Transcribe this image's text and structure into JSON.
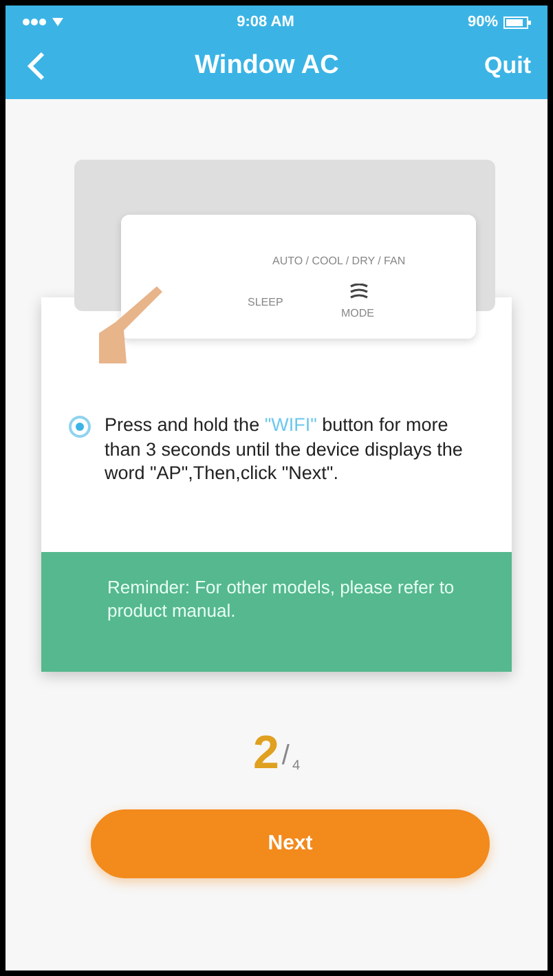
{
  "status_bar": {
    "time": "9:08 AM",
    "battery": "90%"
  },
  "nav": {
    "title": "Window AC",
    "action": "Quit"
  },
  "device_image": {
    "labels": [
      {
        "kind": "mode",
        "text": "AUTO / COOL / DRY / FAN"
      },
      {
        "kind": "sleep",
        "text": "SLEEP"
      },
      {
        "kind": "mode_button",
        "text": "MODE"
      }
    ]
  },
  "instruction": {
    "selected": true,
    "highlight_before": "Press and hold the ",
    "highlight": "\"WIFI\"",
    "highlight_after": " button for more than 3 seconds until the device displays the word \"AP\",Then,click \"Next\"."
  },
  "reminder": "Reminder: For other models, please refer to product manual.",
  "step": {
    "current": "2",
    "separator": "/",
    "total": "4"
  },
  "button": "Next"
}
